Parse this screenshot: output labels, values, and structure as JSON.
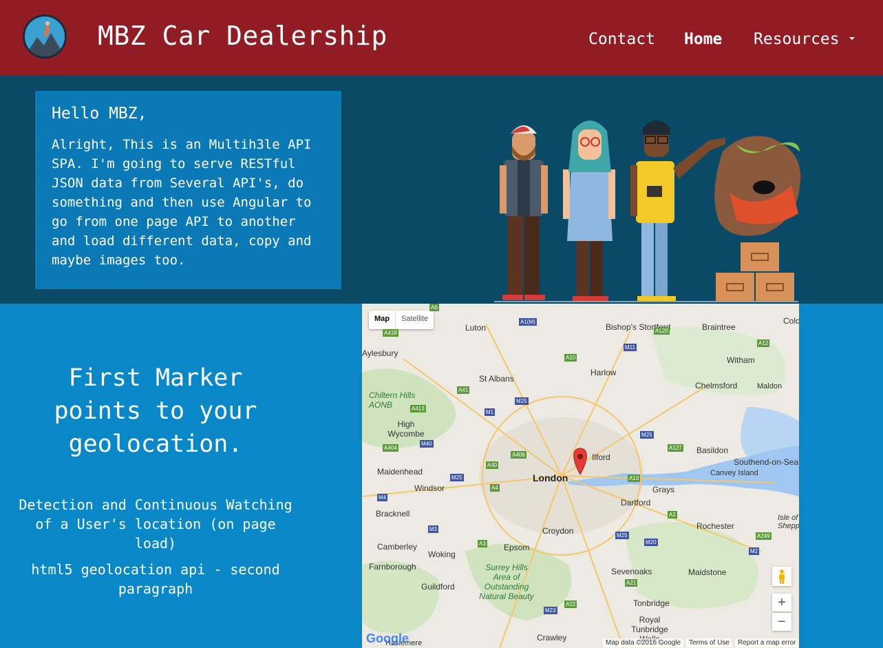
{
  "header": {
    "brand": "MBZ Car Dealership",
    "nav": {
      "contact": "Contact",
      "home": "Home",
      "resources": "Resources"
    }
  },
  "hero": {
    "title": "Hello MBZ,",
    "body": "Alright, This is an Multih3le API SPA. I'm going to serve RESTful JSON data from Several API's, do something and then use Angular to go from one page API to another and load different data, copy and maybe images too."
  },
  "geo": {
    "heading": "First Marker points to your geolocation.",
    "paragraph1": "Detection and Continuous Watching of a User's location (on page load)",
    "paragraph2": "html5 geolocation api - second paragraph"
  },
  "map": {
    "type_map": "Map",
    "type_satellite": "Satellite",
    "places": [
      "Luton",
      "Bishop's Stortford",
      "Braintree",
      "Colc",
      "Aylesbury",
      "Witham",
      "St Albans",
      "Harlow",
      "Chelmsford",
      "Maldon",
      "Chiltern Hills AONB",
      "High Wycombe",
      "Basildon",
      "Southend-on-Sea",
      "Ilford",
      "London",
      "Maidenhead",
      "Canvey Island",
      "Windsor",
      "Grays",
      "Dartford",
      "Bracknell",
      "Croydon",
      "Rochester",
      "Isle of Shepp",
      "Camberley",
      "Woking",
      "Epsom",
      "Farnborough",
      "Surrey Hills Area of Outstanding Natural Beauty",
      "Sevenoaks",
      "Maidstone",
      "Guildford",
      "Tonbridge",
      "Royal Tunbridge Wells",
      "Crawley",
      "Haslemere"
    ],
    "roads": [
      "A6",
      "A1(M)",
      "A418",
      "A120",
      "M11",
      "A12",
      "A10",
      "A41",
      "M25",
      "A413",
      "M1",
      "M40",
      "A404",
      "A406",
      "M25",
      "A127",
      "A40",
      "M25",
      "A13",
      "M4",
      "A4",
      "A2",
      "M3",
      "A3",
      "M25",
      "M20",
      "A249",
      "M2",
      "A21",
      "A22",
      "M23",
      "A2"
    ],
    "zoom_in": "+",
    "zoom_out": "−",
    "google": "Google",
    "attribution_data": "Map data ©2016 Google",
    "attribution_terms": "Terms of Use",
    "attribution_report": "Report a map error"
  },
  "colors": {
    "navbar": "#921c24",
    "hero_bg": "#0a4a66",
    "card_bg": "#0b79b5",
    "bottom_bg": "#0a87c6",
    "marker": "#e53935"
  }
}
